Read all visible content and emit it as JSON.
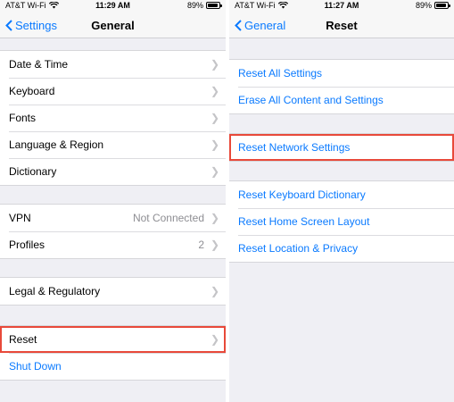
{
  "left": {
    "status": {
      "carrier": "AT&T Wi-Fi",
      "time": "11:29 AM",
      "battery": "89%"
    },
    "nav": {
      "back": "Settings",
      "title": "General"
    },
    "group1": [
      "Date & Time",
      "Keyboard",
      "Fonts",
      "Language & Region",
      "Dictionary"
    ],
    "vpn": {
      "label": "VPN",
      "value": "Not Connected"
    },
    "profiles": {
      "label": "Profiles",
      "value": "2"
    },
    "legal": "Legal & Regulatory",
    "reset": "Reset",
    "shutdown": "Shut Down"
  },
  "right": {
    "status": {
      "carrier": "AT&T Wi-Fi",
      "time": "11:27 AM",
      "battery": "89%"
    },
    "nav": {
      "back": "General",
      "title": "Reset"
    },
    "group1": [
      "Reset All Settings",
      "Erase All Content and Settings"
    ],
    "network": "Reset Network Settings",
    "group3": [
      "Reset Keyboard Dictionary",
      "Reset Home Screen Layout",
      "Reset Location & Privacy"
    ]
  },
  "colors": {
    "accent": "#0a7aff",
    "highlight": "#e8493a",
    "background": "#efeff4"
  }
}
